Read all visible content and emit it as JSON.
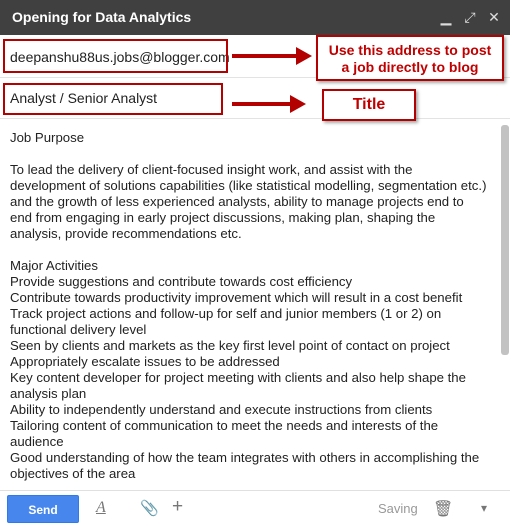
{
  "window": {
    "title": "Opening for Data Analytics",
    "buttons": {
      "minimize": "▁",
      "expand": "⤢",
      "close": "✕"
    }
  },
  "to_field": {
    "value": "deepanshu88us.jobs@blogger.com"
  },
  "subject_field": {
    "value": "Analyst / Senior Analyst"
  },
  "annotations": {
    "address_note": "Use this address to post\na job directly to blog",
    "title_note": "Title"
  },
  "body": {
    "lines": [
      "Job Purpose",
      "",
      "To lead the delivery of client-focused insight work, and assist with the",
      "development of solutions capabilities (like statistical modelling, segmentation etc.)",
      "and the growth of less experienced analysts, ability to manage projects end to",
      "end from engaging in early project discussions, making plan, shaping the",
      "analysis, provide recommendations etc.",
      "",
      "Major Activities",
      "Provide suggestions and contribute towards cost efficiency",
      "Contribute towards productivity improvement which will result in a cost benefit",
      "Track project actions and follow-up for self and junior members (1 or 2) on",
      "functional delivery level",
      "Seen by clients and markets as the key first level point of contact on project",
      "Appropriately escalate issues to be addressed",
      "Key content developer for project meeting with clients and also help shape the",
      "analysis plan",
      "Ability to independently understand and execute instructions from clients",
      "Tailoring content of communication to meet the needs and interests of the",
      "audience",
      "Good understanding of how the team integrates with others in accomplishing the",
      "objectives of the area"
    ]
  },
  "toolbar": {
    "send_label": "Send",
    "format_icon": "A",
    "attach_icon": "📎",
    "more_icon": "+",
    "status": "Saving",
    "trash_icon": "🗑",
    "dropdown_icon": "▾"
  },
  "colors": {
    "annotation_red": "#b30000",
    "send_blue": "#4787ed",
    "titlebar": "#404040"
  }
}
